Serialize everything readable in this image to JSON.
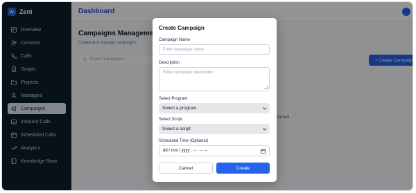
{
  "app": {
    "name": "Zeni"
  },
  "sidebar": {
    "items": [
      {
        "label": "Overview",
        "icon": "dashboard-icon",
        "active": false
      },
      {
        "label": "Contacts",
        "icon": "user-plus-icon",
        "active": false
      },
      {
        "label": "Calls",
        "icon": "phone-icon",
        "active": false
      },
      {
        "label": "Scripts",
        "icon": "scroll-icon",
        "active": false
      },
      {
        "label": "Projects",
        "icon": "folder-icon",
        "active": false
      },
      {
        "label": "Managers",
        "icon": "user-icon",
        "active": false
      },
      {
        "label": "Campaigns",
        "icon": "megaphone-icon",
        "active": true
      },
      {
        "label": "Inbound Calls",
        "icon": "inbox-icon",
        "active": false
      },
      {
        "label": "Scheduled Calls",
        "icon": "calendar-icon",
        "active": false
      },
      {
        "label": "Analytics",
        "icon": "trend-icon",
        "active": false
      },
      {
        "label": "Knowledge Base",
        "icon": "book-icon",
        "active": false
      }
    ]
  },
  "header": {
    "title": "Dashboard"
  },
  "page": {
    "heading": "Campaigns Management",
    "subheading": "Create and manage campaigns",
    "search_placeholder": "Search campaigns...",
    "create_button": "+ Create Campaign",
    "empty_text": "started"
  },
  "modal": {
    "title": "Create Campaign",
    "name_label": "Campaign Name",
    "name_placeholder": "Enter campaign name",
    "description_label": "Description",
    "description_placeholder": "Enter campaign description",
    "program_label": "Select Program",
    "program_value": "Select a program",
    "script_label": "Select Script",
    "script_value": "Select a script",
    "time_label": "Scheduled Time (Optional)",
    "time_value": "dd / mm / yyyy , -- : --  --",
    "cancel_label": "Cancel",
    "create_label": "Create"
  },
  "colors": {
    "sidebar_bg": "#0b1f2a",
    "accent": "#2563eb",
    "title_blue": "#1d4ed8"
  }
}
